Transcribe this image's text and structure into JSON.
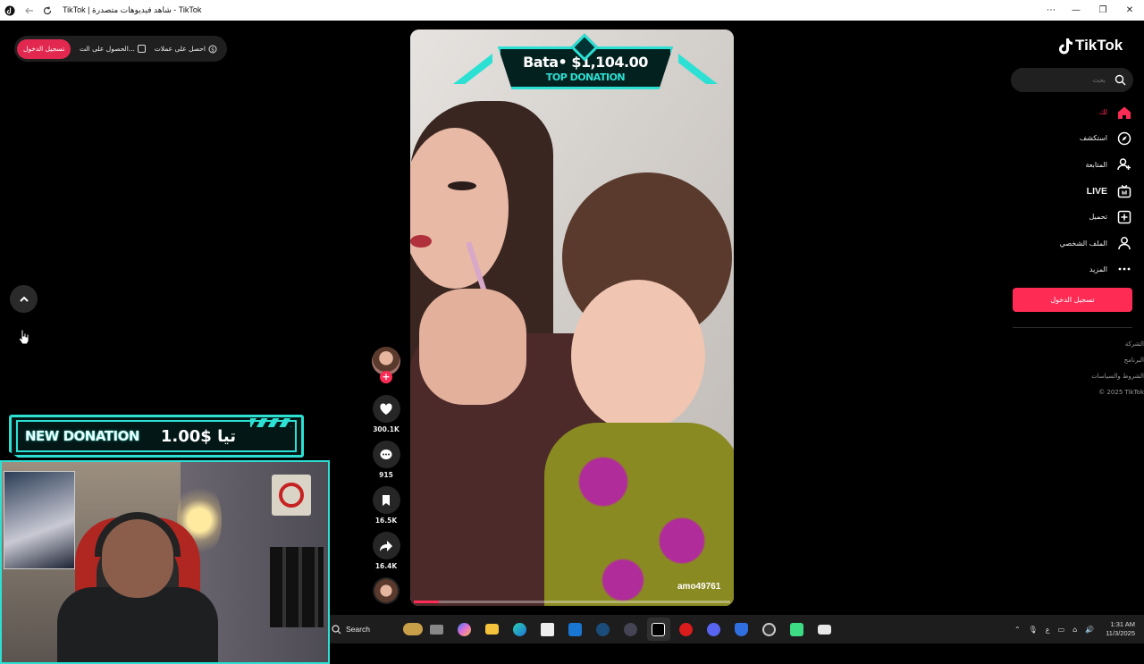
{
  "window": {
    "title": "TikTok | شاهد فيديوهات متصدرة - TikTok"
  },
  "topbar": {
    "login_label": "تسجيل الدخول",
    "get_app_label": "الحصول على الت...",
    "get_coins_label": "احصل على عملات"
  },
  "overlays": {
    "new_donation_title": "NEW DONATION",
    "new_donation_amount": "1.00$ تيا",
    "top_donation_amount": "Bata• $1,104.00",
    "top_donation_label": "TOP DONATION"
  },
  "video": {
    "username": "amo49761",
    "progress": 0.08
  },
  "actions": {
    "likes": "300.1K",
    "comments": "915",
    "saves": "16.5K",
    "shares": "16.4K"
  },
  "sidebar": {
    "logo": "TikTok",
    "search_placeholder": "بحث",
    "items": [
      {
        "label": "لك",
        "icon": "home-icon",
        "active": true
      },
      {
        "label": "استكشف",
        "icon": "compass-icon",
        "active": false
      },
      {
        "label": "المتابعة",
        "icon": "follow-icon",
        "active": false
      },
      {
        "label": "LIVE",
        "icon": "live-icon",
        "active": false
      },
      {
        "label": "تحميل",
        "icon": "upload-icon",
        "active": false
      },
      {
        "label": "الملف الشخصي",
        "icon": "profile-icon",
        "active": false
      },
      {
        "label": "المزيد",
        "icon": "more-icon",
        "active": false
      }
    ],
    "login_button": "تسجيل الدخول",
    "footer": [
      "الشركة",
      "البرنامج",
      "الشروط والسياسات",
      "© 2025 TikTok"
    ]
  },
  "taskbar": {
    "search_label": "Search",
    "lang": "ع",
    "time": "1:31 AM",
    "date": "11/3/2025"
  },
  "colors": {
    "accent": "#fe2c55",
    "overlay_cyan": "#2de0d4",
    "background": "#000000"
  }
}
